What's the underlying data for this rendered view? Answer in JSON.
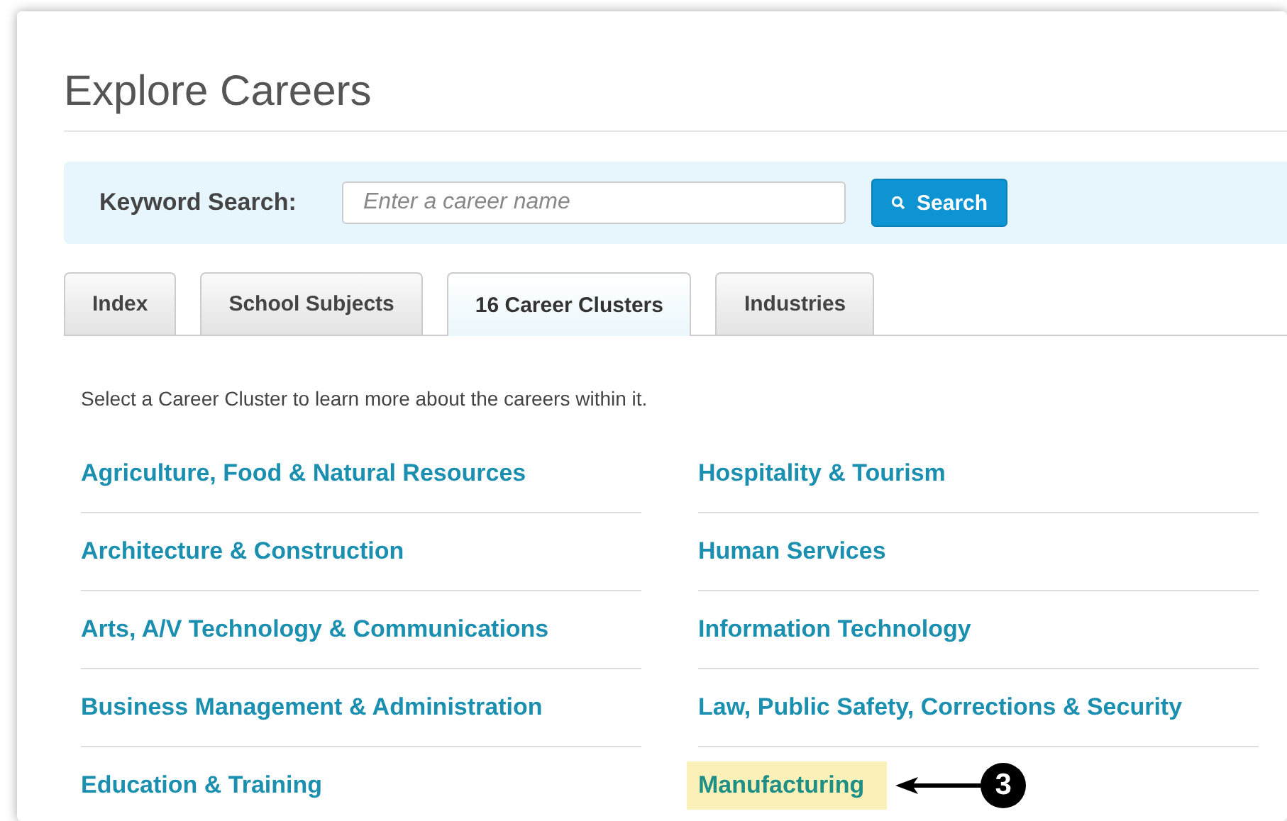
{
  "title": "Explore Careers",
  "search": {
    "label": "Keyword Search:",
    "placeholder": "Enter a career name",
    "button": "Search"
  },
  "tabs": [
    {
      "label": "Index",
      "selected": false
    },
    {
      "label": "School Subjects",
      "selected": false
    },
    {
      "label": "16 Career Clusters",
      "selected": true
    },
    {
      "label": "Industries",
      "selected": false
    }
  ],
  "intro": "Select a Career Cluster to learn more about the careers within it.",
  "clusters": [
    {
      "label": "Agriculture, Food & Natural Resources",
      "highlighted": false
    },
    {
      "label": "Architecture & Construction",
      "highlighted": false
    },
    {
      "label": "Arts, A/V Technology & Communications",
      "highlighted": false
    },
    {
      "label": "Business Management & Administration",
      "highlighted": false
    },
    {
      "label": "Education & Training",
      "highlighted": false
    },
    {
      "label": "Hospitality & Tourism",
      "highlighted": false
    },
    {
      "label": "Human Services",
      "highlighted": false
    },
    {
      "label": "Information Technology",
      "highlighted": false
    },
    {
      "label": "Law, Public Safety, Corrections & Security",
      "highlighted": false
    },
    {
      "label": "Manufacturing",
      "highlighted": true,
      "callout": "3"
    }
  ]
}
